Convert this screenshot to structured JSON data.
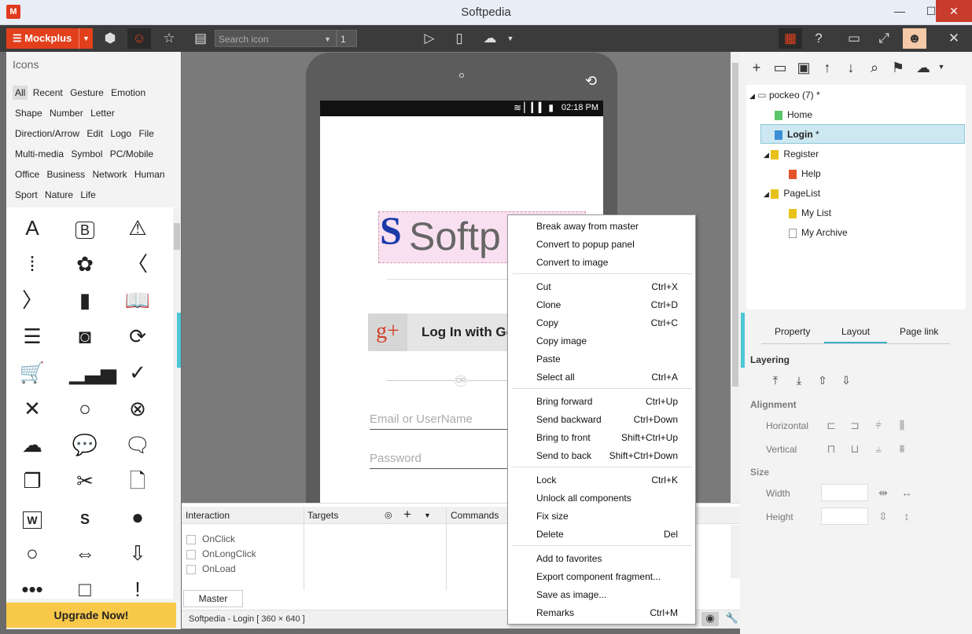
{
  "window": {
    "title": "Softpedia",
    "app_icon": "M",
    "minimize": "—",
    "maximize": "☐",
    "close": "✕"
  },
  "toolbar": {
    "brand": "Mockplus",
    "search_placeholder": "Search icon",
    "search_count": "1"
  },
  "icons_panel": {
    "heading": "Icons",
    "category_rows": [
      [
        "All",
        "Recent",
        "Gesture",
        "Emotion"
      ],
      [
        "Shape",
        "Number",
        "Letter"
      ],
      [
        "Direction/Arrow",
        "Edit",
        "Logo",
        "File"
      ],
      [
        "Multi-media",
        "Symbol",
        "PC/Mobile"
      ],
      [
        "Office",
        "Business",
        "Network",
        "Human"
      ],
      [
        "Sport",
        "Nature",
        "Life"
      ]
    ],
    "selected_category": "All",
    "upgrade_label": "Upgrade Now!"
  },
  "device": {
    "status_time": "02:18 PM",
    "logo_letter": "S",
    "logo_text": "Softp",
    "gplus_text": "Log In with Go",
    "or_text": "OR",
    "email_placeholder": "Email or UserName",
    "password_placeholder": "Password"
  },
  "bottom_panel": {
    "interaction_label": "Interaction",
    "targets_label": "Targets",
    "commands_label": "Commands",
    "events": [
      "OnClick",
      "OnLongClick",
      "OnLoad"
    ],
    "master_tab": "Master",
    "status_text": "Softpedia - Login [ 360 × 640 ]"
  },
  "page_tree": {
    "root": "pockeo (7)",
    "root_star": "*",
    "items": [
      {
        "label": "Home",
        "color": "#5cc66a"
      },
      {
        "label": "Login",
        "color": "#3a8fd6",
        "selected": true,
        "star": "*"
      },
      {
        "label": "Register",
        "color": "#e8c21a"
      },
      {
        "label": "Help",
        "color": "#e2552a"
      },
      {
        "label": "PageList",
        "color": "#e8c21a"
      },
      {
        "label": "My List",
        "color": "#e8c21a"
      },
      {
        "label": "My Archive",
        "color": "#ffffff"
      }
    ]
  },
  "properties": {
    "tabs": [
      "Property",
      "Layout",
      "Page link"
    ],
    "active_tab": "Layout",
    "layering": "Layering",
    "alignment": "Alignment",
    "horizontal": "Horizontal",
    "vertical": "Vertical",
    "size": "Size",
    "width": "Width",
    "height": "Height"
  },
  "context_menu": {
    "groups": [
      [
        {
          "label": "Break away from master",
          "shortcut": ""
        },
        {
          "label": "Convert to popup panel",
          "shortcut": ""
        },
        {
          "label": "Convert to image",
          "shortcut": ""
        }
      ],
      [
        {
          "label": "Cut",
          "shortcut": "Ctrl+X"
        },
        {
          "label": "Clone",
          "shortcut": "Ctrl+D"
        },
        {
          "label": "Copy",
          "shortcut": "Ctrl+C"
        },
        {
          "label": "Copy image",
          "shortcut": ""
        },
        {
          "label": "Paste",
          "shortcut": ""
        },
        {
          "label": "Select all",
          "shortcut": "Ctrl+A"
        }
      ],
      [
        {
          "label": "Bring forward",
          "shortcut": "Ctrl+Up"
        },
        {
          "label": "Send backward",
          "shortcut": "Ctrl+Down"
        },
        {
          "label": "Bring to front",
          "shortcut": "Shift+Ctrl+Up"
        },
        {
          "label": "Send to back",
          "shortcut": "Shift+Ctrl+Down"
        }
      ],
      [
        {
          "label": "Lock",
          "shortcut": "Ctrl+K"
        },
        {
          "label": "Unlock all components",
          "shortcut": ""
        },
        {
          "label": "Fix size",
          "shortcut": ""
        },
        {
          "label": "Delete",
          "shortcut": "Del"
        }
      ],
      [
        {
          "label": "Add to favorites",
          "shortcut": ""
        },
        {
          "label": "Export component fragment...",
          "shortcut": ""
        },
        {
          "label": "Save as image...",
          "shortcut": ""
        },
        {
          "label": "Remarks",
          "shortcut": "Ctrl+M"
        }
      ]
    ]
  },
  "colors": {
    "brand": "#e2401c",
    "accent": "#4ec6d6",
    "upgrade": "#f7c84a"
  }
}
